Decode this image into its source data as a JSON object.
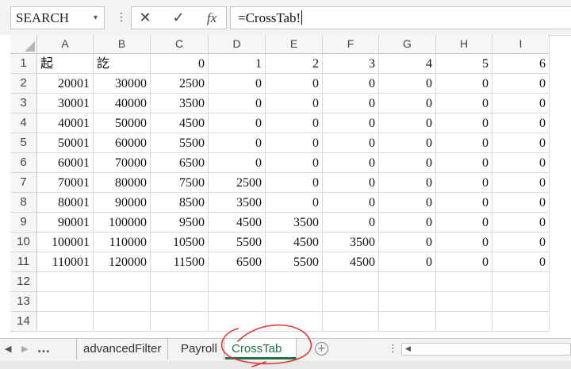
{
  "formula_bar": {
    "name_box": "SEARCH",
    "dropdown_icon": "chevron-down-icon",
    "more_icon": "vertical-ellipsis-icon",
    "cancel_symbol": "✕",
    "enter_symbol": "✓",
    "fx_label": "fx",
    "formula": "=CrossTab!"
  },
  "columns": [
    "A",
    "B",
    "C",
    "D",
    "E",
    "F",
    "G",
    "H",
    "I"
  ],
  "rows": [
    [
      "起",
      "訖",
      "0",
      "1",
      "2",
      "3",
      "4",
      "5",
      "6"
    ],
    [
      "20001",
      "30000",
      "2500",
      "0",
      "0",
      "0",
      "0",
      "0",
      "0"
    ],
    [
      "30001",
      "40000",
      "3500",
      "0",
      "0",
      "0",
      "0",
      "0",
      "0"
    ],
    [
      "40001",
      "50000",
      "4500",
      "0",
      "0",
      "0",
      "0",
      "0",
      "0"
    ],
    [
      "50001",
      "60000",
      "5500",
      "0",
      "0",
      "0",
      "0",
      "0",
      "0"
    ],
    [
      "60001",
      "70000",
      "6500",
      "0",
      "0",
      "0",
      "0",
      "0",
      "0"
    ],
    [
      "70001",
      "80000",
      "7500",
      "2500",
      "0",
      "0",
      "0",
      "0",
      "0"
    ],
    [
      "80001",
      "90000",
      "8500",
      "3500",
      "0",
      "0",
      "0",
      "0",
      "0"
    ],
    [
      "90001",
      "100000",
      "9500",
      "4500",
      "3500",
      "0",
      "0",
      "0",
      "0"
    ],
    [
      "100001",
      "110000",
      "10500",
      "5500",
      "4500",
      "3500",
      "0",
      "0",
      "0"
    ],
    [
      "110001",
      "120000",
      "11500",
      "6500",
      "5500",
      "4500",
      "0",
      "0",
      "0"
    ],
    [
      "",
      "",
      "",
      "",
      "",
      "",
      "",
      "",
      ""
    ],
    [
      "",
      "",
      "",
      "",
      "",
      "",
      "",
      "",
      ""
    ],
    [
      "",
      "",
      "",
      "",
      "",
      "",
      "",
      "",
      ""
    ]
  ],
  "row_numbers": [
    "1",
    "2",
    "3",
    "4",
    "5",
    "6",
    "7",
    "8",
    "9",
    "10",
    "11",
    "12",
    "13",
    "14"
  ],
  "sheet_tabs": {
    "prev_symbol": "◀",
    "next_symbol": "▶",
    "more_label": "...",
    "tabs": [
      "advancedFilter",
      "Payroll",
      "CrossTab"
    ],
    "active": "CrossTab",
    "add_icon": "plus-circle-icon",
    "add_symbol": "+",
    "split_symbol": "⋮",
    "scroll_left_symbol": "◀"
  },
  "colors": {
    "active_tab": "#217346",
    "annotation": "#e53935"
  }
}
